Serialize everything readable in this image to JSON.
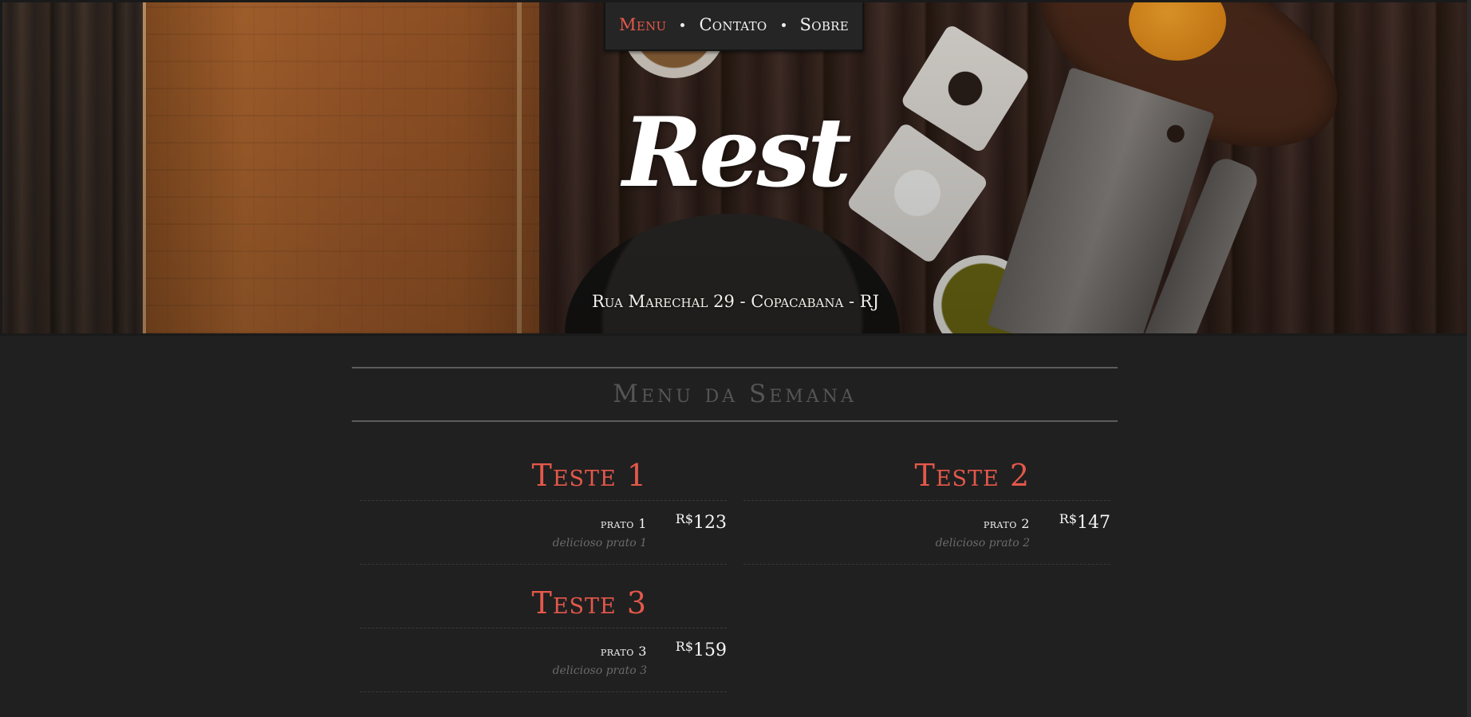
{
  "nav": {
    "items": [
      {
        "label": "Menu",
        "active": true
      },
      {
        "label": "Contato",
        "active": false
      },
      {
        "label": "Sobre",
        "active": false
      }
    ]
  },
  "hero": {
    "logo": "Rest",
    "address": "Rua Marechal 29 - Copacabana - RJ"
  },
  "menu": {
    "title": "Menu da Semana",
    "categories": [
      {
        "title": "Teste 1",
        "item": {
          "name": "prato 1",
          "desc": "delicioso prato 1",
          "currency": "R$",
          "price": "123"
        }
      },
      {
        "title": "Teste 2",
        "item": {
          "name": "prato 2",
          "desc": "delicioso prato 2",
          "currency": "R$",
          "price": "147"
        }
      },
      {
        "title": "Teste 3",
        "item": {
          "name": "prato 3",
          "desc": "delicioso prato 3",
          "currency": "R$",
          "price": "159"
        }
      }
    ]
  },
  "colors": {
    "accent": "#e4584a",
    "background": "#202020",
    "nav_bg": "#252525"
  }
}
